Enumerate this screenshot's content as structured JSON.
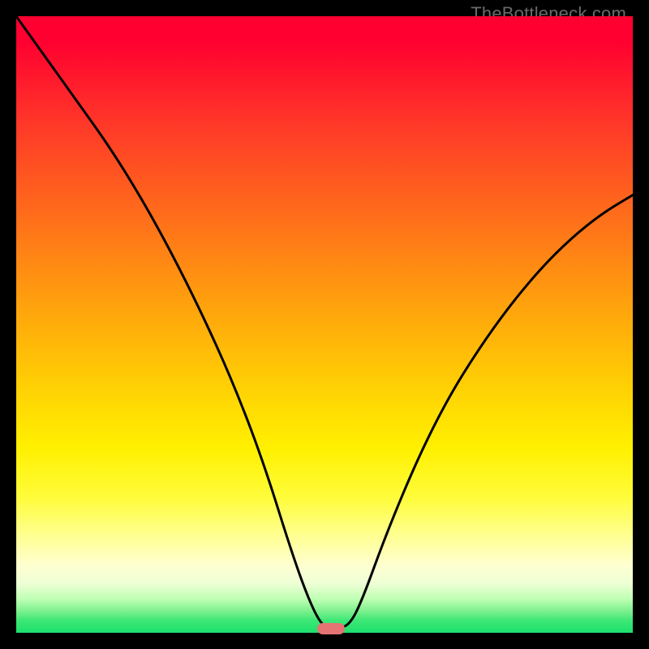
{
  "watermark": {
    "text": "TheBottleneck.com"
  },
  "chart_data": {
    "type": "line",
    "title": "",
    "xlabel": "",
    "ylabel": "",
    "xlim": [
      0,
      100
    ],
    "ylim": [
      0,
      100
    ],
    "grid": false,
    "legend": false,
    "series": [
      {
        "name": "bottleneck-curve",
        "x": [
          0,
          5,
          10,
          15,
          20,
          25,
          30,
          35,
          40,
          45,
          48,
          50,
          52,
          54,
          56,
          60,
          65,
          70,
          75,
          80,
          85,
          90,
          95,
          100
        ],
        "y": [
          100,
          93,
          86,
          79,
          71,
          62,
          52,
          41,
          28,
          12,
          4,
          0.7,
          0.7,
          1.2,
          5,
          16,
          28,
          38,
          46,
          53,
          59,
          64,
          68,
          71
        ]
      }
    ],
    "minimum_marker": {
      "x": 51,
      "y": 0.7
    },
    "background_gradient": {
      "top_color": "#ff0030",
      "bottom_color": "#1de06d"
    }
  }
}
